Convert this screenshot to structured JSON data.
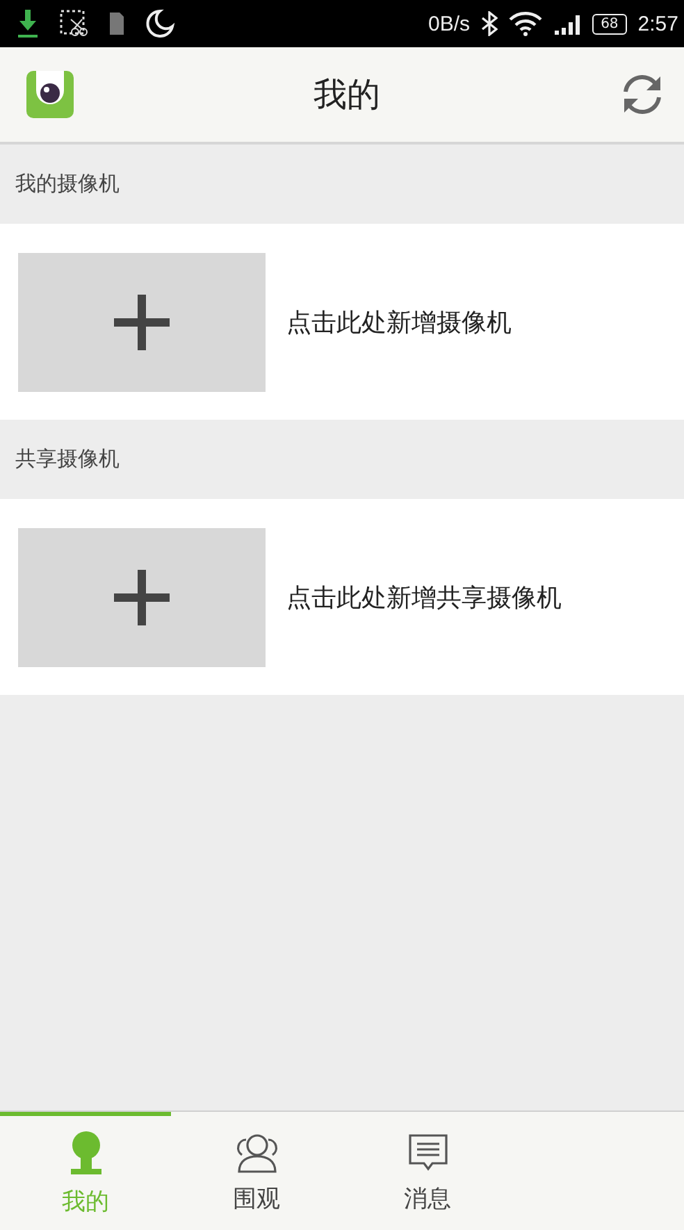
{
  "status_bar": {
    "net_speed": "0B/s",
    "battery": "68",
    "time": "2:57"
  },
  "header": {
    "title": "我的"
  },
  "sections": [
    {
      "title": "我的摄像机",
      "add_label": "点击此处新增摄像机"
    },
    {
      "title": "共享摄像机",
      "add_label": "点击此处新增共享摄像机"
    }
  ],
  "tabs": [
    {
      "label": "我的",
      "kind": "person",
      "selected": true
    },
    {
      "label": "围观",
      "kind": "group",
      "selected": false
    },
    {
      "label": "消息",
      "kind": "message",
      "selected": false
    }
  ]
}
